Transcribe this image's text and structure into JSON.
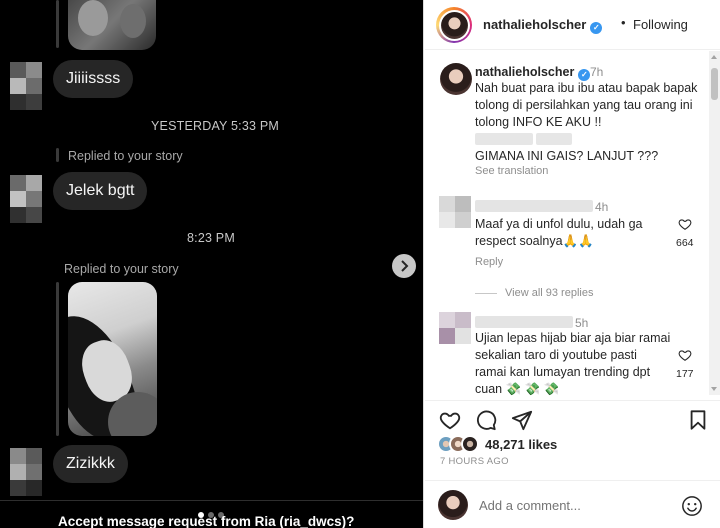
{
  "dm": {
    "messages": {
      "m1": "Jiiiissss",
      "m2": "Jelek bgtt",
      "m3": "Zizikkk"
    },
    "timestamps": {
      "t1": "YESTERDAY 5:33 PM",
      "t2": "8:23 PM"
    },
    "replied_label_1": "Replied to your story",
    "replied_label_2": "Replied to your story",
    "accept_prompt": "Accept message request from Ria (ria_dwcs)?",
    "carousel": {
      "count": 3,
      "active": 1
    }
  },
  "post": {
    "header": {
      "username": "nathalieholscher",
      "dot": "•",
      "follow_label": "Following"
    },
    "caption": {
      "username": "nathalieholscher",
      "time": "7h",
      "line1": "Nah buat para ibu ibu atau bapak bapak tolong di persilahkan yang tau orang ini tolong INFO KE AKU !!",
      "line2": "GIMANA INI GAIS? LANJUT ???",
      "see_translation": "See translation"
    },
    "comments": [
      {
        "time": "4h",
        "text": "Maaf ya di unfol dulu, udah ga respect soalnya🙏🙏",
        "likes": "664",
        "reply_label": "Reply",
        "view_replies": "View all 93 replies"
      },
      {
        "time": "5h",
        "text": "Ujian lepas hijab biar aja biar ramai sekalian taro di youtube pasti ramai kan lumayan trending dpt cuan 💸 💸 💸",
        "likes": "177"
      }
    ],
    "likes_text": "48,271 likes",
    "time_ago": "7 HOURS AGO",
    "add_comment_placeholder": "Add a comment..."
  },
  "colors": {
    "dm_background": "#000000",
    "bubble": "#262626",
    "verified_blue": "#3897f0",
    "muted_text": "#8e8e8e"
  },
  "icons": [
    "verified-badge-icon",
    "heart-icon",
    "comment-icon",
    "share-icon",
    "bookmark-icon",
    "emoji-icon",
    "chevron-right-icon"
  ]
}
